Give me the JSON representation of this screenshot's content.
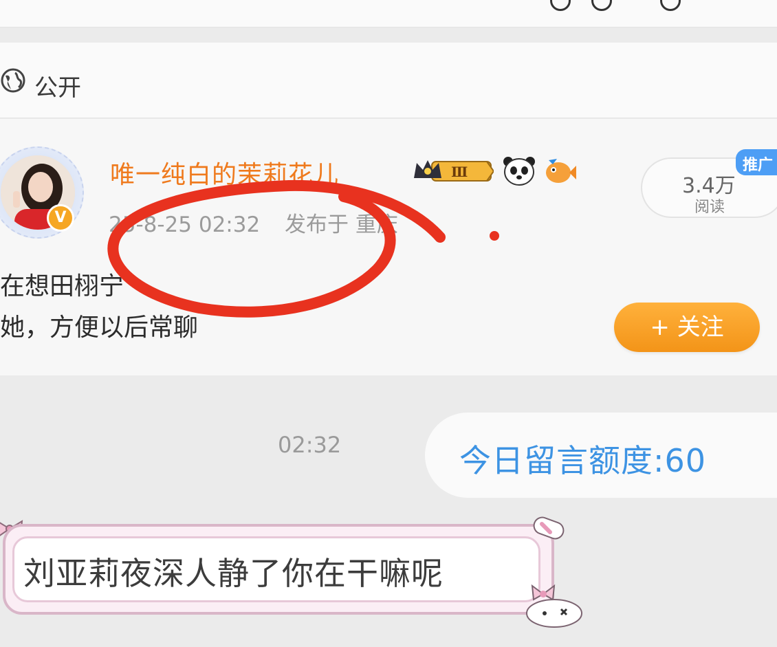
{
  "public_row": {
    "label": "公开",
    "icon": "globe-icon"
  },
  "post": {
    "username": "唯一纯白的茉莉花儿",
    "level_badge_text": "Ⅲ",
    "timestamp": "25-8-25 02:32",
    "location": "发布于 重庆",
    "reads_count": "3.4万",
    "reads_label": "阅读",
    "promo_tag": "推广",
    "body_line1": "在想田栩宁",
    "body_line2": "她，方便以后常聊",
    "follow_label": "+ 关注",
    "verified_badge": "V",
    "icons": [
      "crown-icon",
      "panda-icon",
      "fish-icon"
    ]
  },
  "chat": {
    "time": "02:32",
    "system_message": "今日留言额度:60",
    "user_message": "刘亚莉夜深人静了你在干嘛呢"
  },
  "colors": {
    "username": "#ef7a1d",
    "follow_button": "#f39418",
    "system_message": "#3d93e3",
    "annotation_red": "#e8321f",
    "promo_tag": "#4d9ef5"
  }
}
